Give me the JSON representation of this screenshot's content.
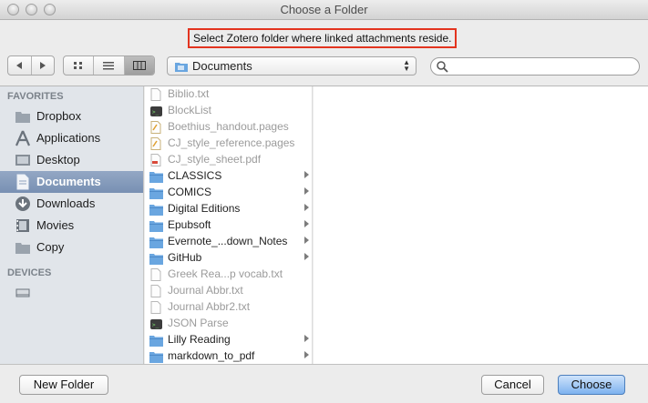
{
  "window": {
    "title": "Choose a Folder"
  },
  "prompt": "Select Zotero folder where linked attachments reside.",
  "toolbar": {
    "location": "Documents",
    "search": {
      "placeholder": "",
      "value": ""
    }
  },
  "sidebar": {
    "favorites_header": "FAVORITES",
    "favorites": [
      {
        "label": "Dropbox",
        "icon": "folder-icon"
      },
      {
        "label": "Applications",
        "icon": "applications-icon"
      },
      {
        "label": "Desktop",
        "icon": "desktop-icon"
      },
      {
        "label": "Documents",
        "icon": "documents-icon",
        "selected": true
      },
      {
        "label": "Downloads",
        "icon": "downloads-icon"
      },
      {
        "label": "Movies",
        "icon": "movies-icon"
      },
      {
        "label": "Copy",
        "icon": "folder-icon"
      }
    ],
    "devices_header": "DEVICES",
    "devices": [
      {
        "label": "",
        "icon": "drive-icon"
      }
    ]
  },
  "browser": {
    "column1": [
      {
        "name": "Biblio.txt",
        "kind": "file",
        "enabled": false
      },
      {
        "name": "BlockList",
        "kind": "exec",
        "enabled": false
      },
      {
        "name": "Boethius_handout.pages",
        "kind": "pages",
        "enabled": false
      },
      {
        "name": "CJ_style_reference.pages",
        "kind": "pages",
        "enabled": false
      },
      {
        "name": "CJ_style_sheet.pdf",
        "kind": "pdf",
        "enabled": false
      },
      {
        "name": "CLASSICS",
        "kind": "folder",
        "enabled": true
      },
      {
        "name": "COMICS",
        "kind": "folder",
        "enabled": true
      },
      {
        "name": "Digital Editions",
        "kind": "folder",
        "enabled": true
      },
      {
        "name": "Epubsoft",
        "kind": "folder",
        "enabled": true
      },
      {
        "name": "Evernote_...down_Notes",
        "kind": "folder",
        "enabled": true
      },
      {
        "name": "GitHub",
        "kind": "folder",
        "enabled": true
      },
      {
        "name": "Greek Rea...p vocab.txt",
        "kind": "file",
        "enabled": false
      },
      {
        "name": "Journal Abbr.txt",
        "kind": "file",
        "enabled": false
      },
      {
        "name": "Journal Abbr2.txt",
        "kind": "file",
        "enabled": false
      },
      {
        "name": "JSON Parse",
        "kind": "exec",
        "enabled": false
      },
      {
        "name": "Lilly Reading",
        "kind": "folder",
        "enabled": true
      },
      {
        "name": "markdown_to_pdf",
        "kind": "folder",
        "enabled": true
      }
    ]
  },
  "buttons": {
    "new_folder": "New Folder",
    "cancel": "Cancel",
    "choose": "Choose"
  },
  "colors": {
    "highlight_border": "#e3341f",
    "sidebar_selection": "#7f96b8",
    "primary_button": "#7db2ef",
    "folder": "#6aa6e0"
  }
}
